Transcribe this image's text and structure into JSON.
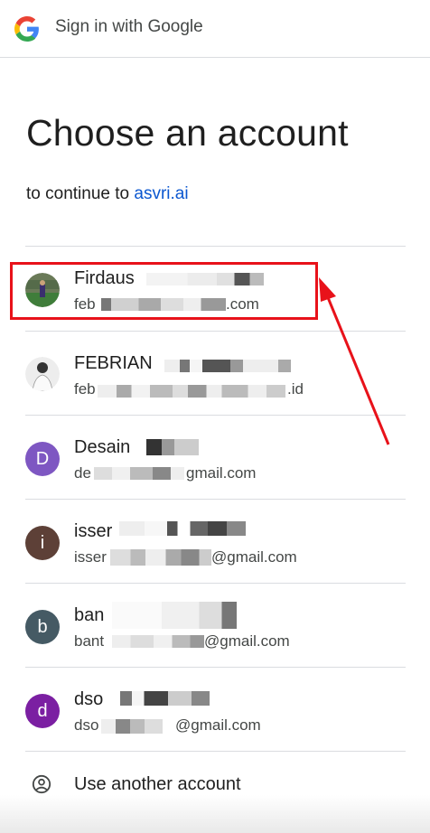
{
  "header": {
    "title": "Sign in with Google",
    "logo_icon": "google-g-logo"
  },
  "page": {
    "heading": "Choose an account",
    "subtitle_prefix": "to continue to ",
    "subtitle_link": "asvri.ai"
  },
  "accounts": [
    {
      "name": "Firdaus",
      "email_start": "feb",
      "email_end": ".com",
      "avatar": "photo"
    },
    {
      "name": "FEBRIAN",
      "email_start": "feb",
      "email_end": ".id",
      "avatar": "photo"
    },
    {
      "name": "Desain",
      "email_start": "de",
      "email_end": "gmail.com",
      "avatar": "D",
      "avatar_color": "#7e57c2"
    },
    {
      "name": "isser",
      "email_start": "isser",
      "email_end": "@gmail.com",
      "avatar": "i",
      "avatar_color": "#5d4037"
    },
    {
      "name": "ban",
      "email_start": "bant",
      "email_end": "@gmail.com",
      "avatar": "b",
      "avatar_color": "#455a64"
    },
    {
      "name": "dso",
      "email_start": "dso",
      "email_end": "@gmail.com",
      "avatar": "d",
      "avatar_color": "#7b1fa2"
    }
  ],
  "use_another": {
    "label": "Use another account",
    "icon": "account-circle-icon"
  },
  "annotation": {
    "highlight_color": "#e8121a"
  }
}
